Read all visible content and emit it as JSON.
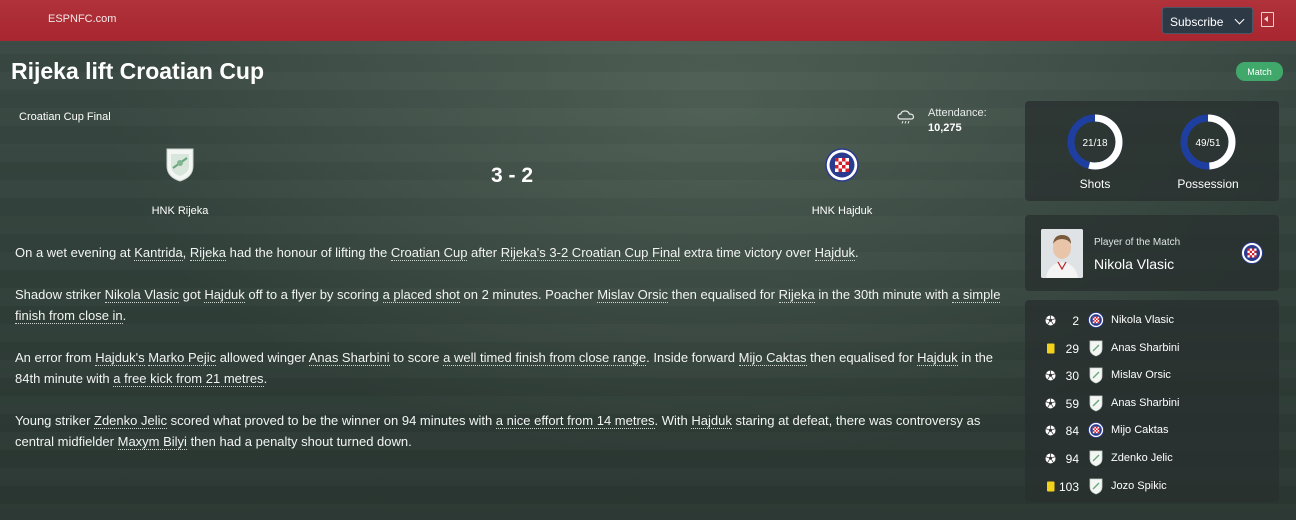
{
  "header": {
    "brand": "ESPNFC.com",
    "subscribe_label": "Subscribe"
  },
  "article": {
    "title": "Rijeka lift Croatian Cup",
    "badge": "Match",
    "competition": "Croatian Cup Final",
    "attendance_label": "Attendance:",
    "attendance_value": "10,275",
    "weather": "rain-cloud-icon",
    "home_team": "HNK Rijeka",
    "away_team": "HNK Hajduk",
    "score": "3 - 2"
  },
  "report": {
    "p1": [
      {
        "t": "On a wet evening at "
      },
      {
        "t": "Kantrida",
        "u": true
      },
      {
        "t": ", "
      },
      {
        "t": "Rijeka",
        "u": true
      },
      {
        "t": " had the honour of lifting the "
      },
      {
        "t": "Croatian Cup",
        "u": true
      },
      {
        "t": " after "
      },
      {
        "t": "Rijeka's 3-2 Croatian Cup Final",
        "u": true
      },
      {
        "t": " extra time victory over "
      },
      {
        "t": "Hajduk",
        "u": true
      },
      {
        "t": "."
      }
    ],
    "p2": [
      {
        "t": "Shadow striker "
      },
      {
        "t": "Nikola Vlasic",
        "u": true
      },
      {
        "t": " got "
      },
      {
        "t": "Hajduk",
        "u": true
      },
      {
        "t": " off to a flyer by scoring "
      },
      {
        "t": "a placed shot",
        "u": true
      },
      {
        "t": " on 2 minutes. Poacher "
      },
      {
        "t": "Mislav Orsic",
        "u": true
      },
      {
        "t": " then equalised for "
      },
      {
        "t": "Rijeka",
        "u": true
      },
      {
        "t": " in the 30th minute with "
      },
      {
        "t": "a simple finish from close in",
        "u": true
      },
      {
        "t": "."
      }
    ],
    "p3": [
      {
        "t": "An error from "
      },
      {
        "t": "Hajduk's",
        "u": true
      },
      {
        "t": " "
      },
      {
        "t": "Marko Pejic",
        "u": true
      },
      {
        "t": " allowed winger "
      },
      {
        "t": "Anas Sharbini",
        "u": true
      },
      {
        "t": " to score "
      },
      {
        "t": "a well timed finish from close range",
        "u": true
      },
      {
        "t": ". Inside forward "
      },
      {
        "t": "Mijo Caktas",
        "u": true
      },
      {
        "t": " then equalised for "
      },
      {
        "t": "Hajduk",
        "u": true
      },
      {
        "t": " in the 84th minute with "
      },
      {
        "t": "a free kick from 21 metres",
        "u": true
      },
      {
        "t": "."
      }
    ],
    "p4": [
      {
        "t": "Young striker "
      },
      {
        "t": "Zdenko Jelic",
        "u": true
      },
      {
        "t": " scored what proved to be the winner on 94 minutes with "
      },
      {
        "t": "a nice effort from 14 metres",
        "u": true
      },
      {
        "t": ". With "
      },
      {
        "t": "Hajduk",
        "u": true
      },
      {
        "t": " staring at defeat, there was controversy as central midfielder "
      },
      {
        "t": "Maxym Bilyi",
        "u": true
      },
      {
        "t": " then had a penalty shout turned down."
      }
    ]
  },
  "stats": {
    "shots_text": "21/18",
    "shots_label": "Shots",
    "shots_home": 21,
    "shots_away": 18,
    "possession_text": "49/51",
    "possession_label": "Possession",
    "possession_home": 49,
    "possession_away": 51,
    "home_color": "#ffffff",
    "away_color": "#1f3fa0"
  },
  "player_of_match": {
    "label": "Player of the Match",
    "name": "Nikola Vlasic",
    "team": "hajduk"
  },
  "events": [
    {
      "icon": "ball-icon",
      "minute": "2",
      "team": "hajduk",
      "player": "Nikola Vlasic"
    },
    {
      "icon": "yellow-card-icon",
      "minute": "29",
      "team": "rijeka",
      "player": "Anas Sharbini"
    },
    {
      "icon": "ball-icon",
      "minute": "30",
      "team": "rijeka",
      "player": "Mislav Orsic"
    },
    {
      "icon": "ball-icon",
      "minute": "59",
      "team": "rijeka",
      "player": "Anas Sharbini"
    },
    {
      "icon": "ball-icon",
      "minute": "84",
      "team": "hajduk",
      "player": "Mijo Caktas"
    },
    {
      "icon": "ball-icon",
      "minute": "94",
      "team": "rijeka",
      "player": "Zdenko Jelic"
    },
    {
      "icon": "yellow-card-icon",
      "minute": "103",
      "team": "rijeka",
      "player": "Jozo Spikic"
    }
  ]
}
